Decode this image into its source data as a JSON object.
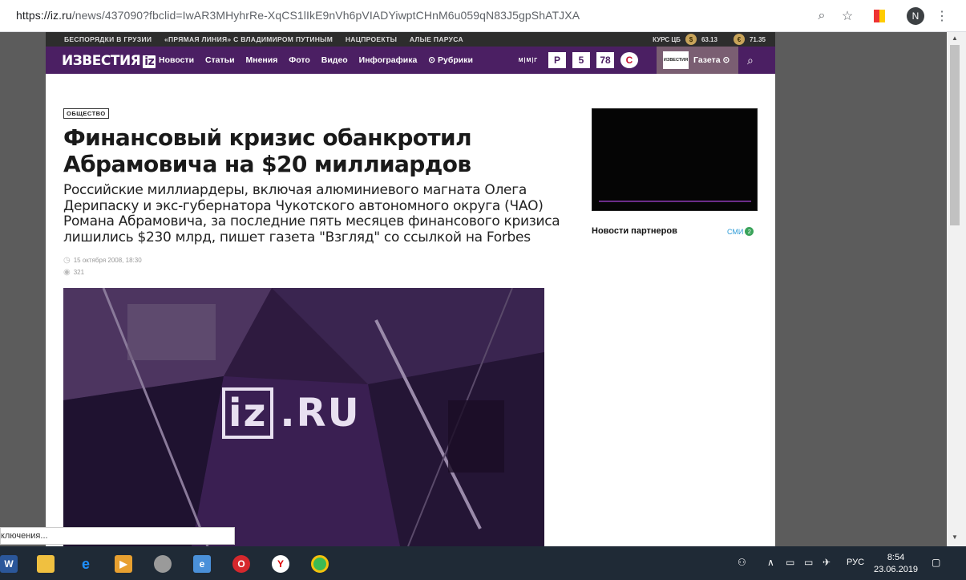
{
  "browser": {
    "url_host": "https://iz.ru",
    "url_path": "/news/437090?fbclid=IwAR3MHyhrRe-XqCS1lIkE9nVh6pVIADYiwptCHnM6u059qN83J5gpShATJXA",
    "profile_initial": "N"
  },
  "topstrip": {
    "links": [
      "БЕСПОРЯДКИ В ГРУЗИИ",
      "«ПРЯМАЯ ЛИНИЯ» С ВЛАДИМИРОМ ПУТИНЫМ",
      "НАЦПРОЕКТЫ",
      "АЛЫЕ ПАРУСА"
    ],
    "rates_label": "КУРС ЦБ",
    "usd_symbol": "$",
    "usd": "63.13",
    "eur_symbol": "€",
    "eur": "71.35"
  },
  "navbar": {
    "logo": "ИЗВЕСТИЯ",
    "logo_iz": "iz",
    "links": [
      "Новости",
      "Статьи",
      "Мнения",
      "Фото",
      "Видео",
      "Инфографика",
      "⊙ Рубрики"
    ],
    "channels": [
      "М|М|Г",
      "Р",
      "5",
      "78",
      "С"
    ],
    "gazeta_mini": "ИЗВЕСТИЯ",
    "gazeta": "Газета ⊙"
  },
  "article": {
    "category": "ОБЩЕСТВО",
    "headline": "Финансовый кризис обанкротил Абрамовича на $20 миллиардов",
    "lead": "Российские миллиардеры, включая алюминиевого магната Олега Дерипаску и экс-губернатора Чукотского автономного округа (ЧАО) Романа Абрамовича, за последние пять месяцев финансового кризиса лишились $230 млрд, пишет газета \"Взгляд\" со ссылкой на Forbes",
    "date": "15 октября 2008, 18:30",
    "views": "321",
    "hero_text": ".RU",
    "hero_box": "iz"
  },
  "sidebar": {
    "partners": "Новости партнеров",
    "smi": "СМИ",
    "smi_count": "2"
  },
  "status_bar": "ключения...",
  "taskbar": {
    "lang": "РУС",
    "time": "8:54",
    "date": "23.06.2019"
  }
}
